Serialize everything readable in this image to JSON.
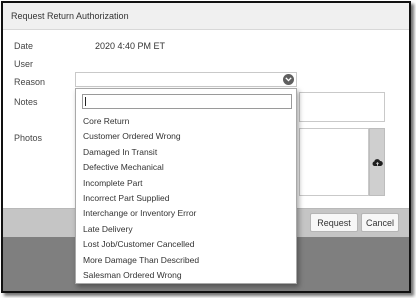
{
  "dialog": {
    "title": "Request Return Authorization"
  },
  "form": {
    "date_label": "Date",
    "date_value": "2020 4:40 PM ET",
    "user_label": "User",
    "reason_label": "Reason",
    "notes_label": "Notes",
    "photos_label": "Photos"
  },
  "dropdown": {
    "search_value": "",
    "options": [
      "Core Return",
      "Customer Ordered Wrong",
      "Damaged In Transit",
      "Defective Mechanical",
      "Incomplete Part",
      "Incorrect Part Supplied",
      "Interchange or Inventory Error",
      "Late Delivery",
      "Lost Job/Customer Cancelled",
      "More Damage Than Described",
      "Salesman Ordered Wrong"
    ]
  },
  "footer": {
    "request_label": "Request",
    "cancel_label": "Cancel"
  },
  "icons": {
    "reason_toggle": "chevron-down-icon",
    "upload": "cloud-upload-icon"
  }
}
